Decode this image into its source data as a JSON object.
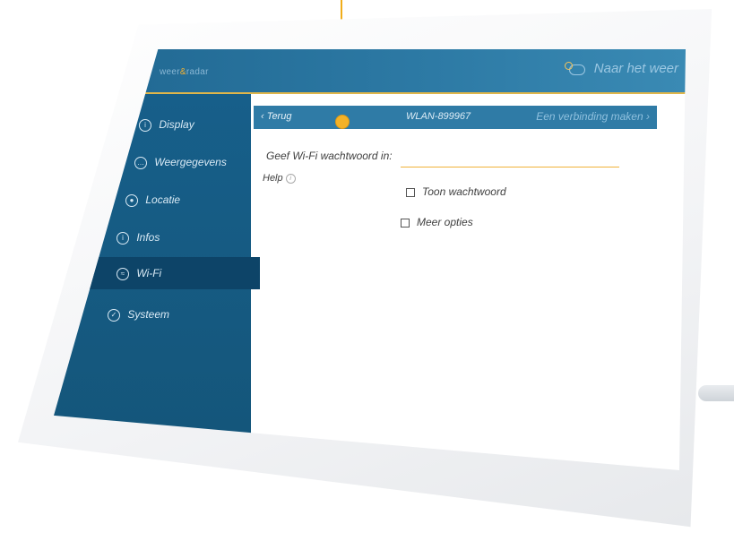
{
  "header": {
    "logo_prefix": "weer",
    "logo_number": "&",
    "logo_suffix": "radar",
    "weather_link": "Naar het weer"
  },
  "sidebar": {
    "items": [
      {
        "label": "Display",
        "icon": "display-icon"
      },
      {
        "label": "Weergegevens",
        "icon": "dots-icon"
      },
      {
        "label": "Locatie",
        "icon": "location-icon"
      },
      {
        "label": "Infos",
        "icon": "info-icon"
      },
      {
        "label": "Wi-Fi",
        "icon": "wifi-icon",
        "active": true
      },
      {
        "label": "Systeem",
        "icon": "check-icon"
      }
    ]
  },
  "content": {
    "back_label": "Terug",
    "ssid": "WLAN-899967",
    "connect_label": "Een verbinding maken",
    "password_label": "Geef Wi-Fi wachtwoord in:",
    "password_value": "",
    "help_label": "Help",
    "show_password_label": "Toon wachtwoord",
    "more_options_label": "Meer opties"
  },
  "colors": {
    "accent": "#f0b338",
    "sidebar": "#175f8a",
    "topbar": "#2d7aa5"
  }
}
